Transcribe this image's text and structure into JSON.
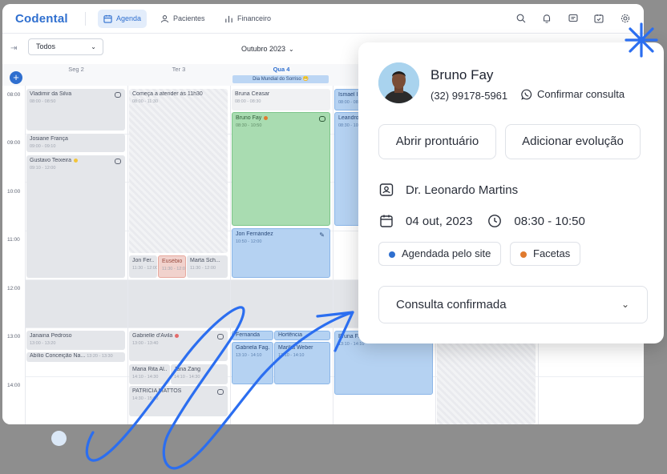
{
  "app": {
    "logo": "Codental"
  },
  "nav": [
    {
      "label": "Agenda",
      "icon": "calendar-icon",
      "active": true
    },
    {
      "label": "Pacientes",
      "icon": "user-icon",
      "active": false
    },
    {
      "label": "Financeiro",
      "icon": "bar-chart-icon",
      "active": false
    }
  ],
  "topbar_icons": [
    "search-icon",
    "bell-icon",
    "chat-icon",
    "calendar-check-icon",
    "gear-icon"
  ],
  "calendar": {
    "filter": "Todos",
    "month": "Outubro 2023",
    "days": [
      "Seg 2",
      "Ter 3",
      "Qua 4"
    ],
    "holiday": "Dia Mundial do Sorriso 😁",
    "hours": [
      "08:00",
      "09:00",
      "10:00",
      "11:00",
      "12:00",
      "13:00",
      "14:00"
    ],
    "events": {
      "vladimir": {
        "title": "Vladimir da Silva",
        "time": "08:00 - 08:50"
      },
      "josiane": {
        "title": "Josiane França",
        "time": "09:00 - 09:10"
      },
      "gustavo": {
        "title": "Gustavo Teixeira",
        "time": "09:10 - 12:00"
      },
      "janaina": {
        "title": "Janaina Pedroso",
        "time": "13:00 - 13:20"
      },
      "abilio": {
        "title": "Abílio Conceição Na...",
        "time": "13:20 - 13:30"
      },
      "comeca": {
        "title": "Começa a atender às 11h30",
        "time": "08:00 - 11:30"
      },
      "jonfer": {
        "title": "Jon Fer...",
        "time": "11:30 - 12:00"
      },
      "eusebio": {
        "title": "Eusébio",
        "time": "11:30 - 12:00"
      },
      "marta": {
        "title": "Marta Sch...",
        "time": "11:30 - 12:00"
      },
      "gabrielle": {
        "title": "Gabrielle d'Avila",
        "time": "13:00 - 13:40"
      },
      "mariarita": {
        "title": "Maria Rita Al...",
        "time": "14:10 - 14:30"
      },
      "janazang": {
        "title": "Jana Zang",
        "time": "14:10 - 14:30"
      },
      "patricia": {
        "title": "PATRICIA MATTOS",
        "time": "14:30 - 15:00"
      },
      "bruna": {
        "title": "Bruna Ceasar",
        "time": "08:00 - 08:30"
      },
      "brunofay": {
        "title": "Bruno Fay",
        "time": "08:30 - 10:50"
      },
      "jonfernandez": {
        "title": "Jon Fernández",
        "time": "10:50 - 12:00"
      },
      "fernanda": {
        "title": "Fernanda",
        "time": ""
      },
      "hortencia": {
        "title": "Hortência",
        "time": ""
      },
      "gabrielafag": {
        "title": "Gabriela Fag...",
        "time": "13:10 - 14:10"
      },
      "mariliaweber": {
        "title": "Marília Weber",
        "time": "13:10 - 14:10"
      },
      "ismael": {
        "title": "Ismael I...",
        "time": "08:00 - 08:30"
      },
      "leandro": {
        "title": "Leandro...",
        "time": "08:30 - 10:..."
      },
      "bruna2": {
        "title": "Bruna F...",
        "time": "13:10 - 14:10"
      }
    }
  },
  "popup": {
    "patient_name": "Bruno Fay",
    "phone": "(32) 99178-5961",
    "confirm_label": "Confirmar consulta",
    "btn_open_record": "Abrir prontuário",
    "btn_add_evolution": "Adicionar evolução",
    "doctor": "Dr. Leonardo Martins",
    "date": "04 out, 2023",
    "time": "08:30 - 10:50",
    "tags": [
      {
        "label": "Agendada pelo site",
        "color": "#2f6fcf"
      },
      {
        "label": "Facetas",
        "color": "#e07a2e"
      }
    ],
    "status": "Consulta confirmada"
  },
  "colors": {
    "accent": "#2f6fcf",
    "green_event": "#a9dcb1",
    "blue_event": "#b5d2f2",
    "lunch": "#e3e5e9"
  }
}
